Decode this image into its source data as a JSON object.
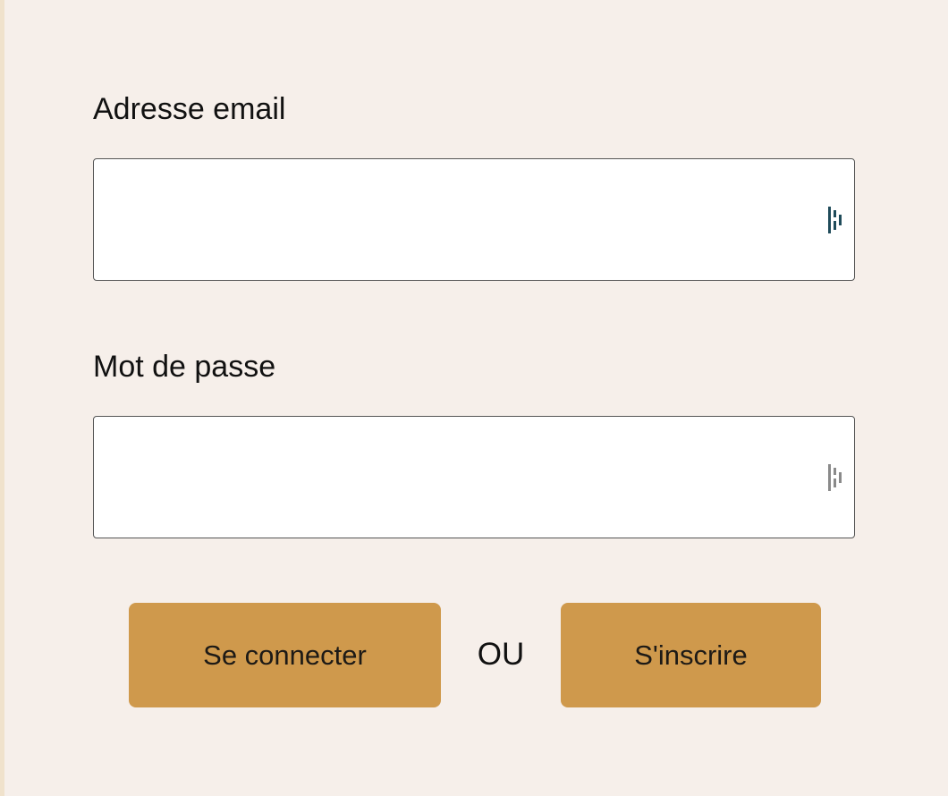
{
  "login_form": {
    "email": {
      "label": "Adresse email",
      "value": "",
      "placeholder": "",
      "autofill_icon": "password-manager-icon",
      "autofill_icon_color": "#1f4b5a"
    },
    "password": {
      "label": "Mot de passe",
      "value": "",
      "placeholder": "",
      "autofill_icon": "password-manager-icon",
      "autofill_icon_color": "#8a8a8a"
    },
    "login_button_label": "Se connecter",
    "separator_label": "OU",
    "signup_button_label": "S'inscrire"
  },
  "colors": {
    "page_background": "#f6efea",
    "edge_strip": "#f0e2cc",
    "button_background": "#cf994c",
    "input_border": "#555555"
  }
}
